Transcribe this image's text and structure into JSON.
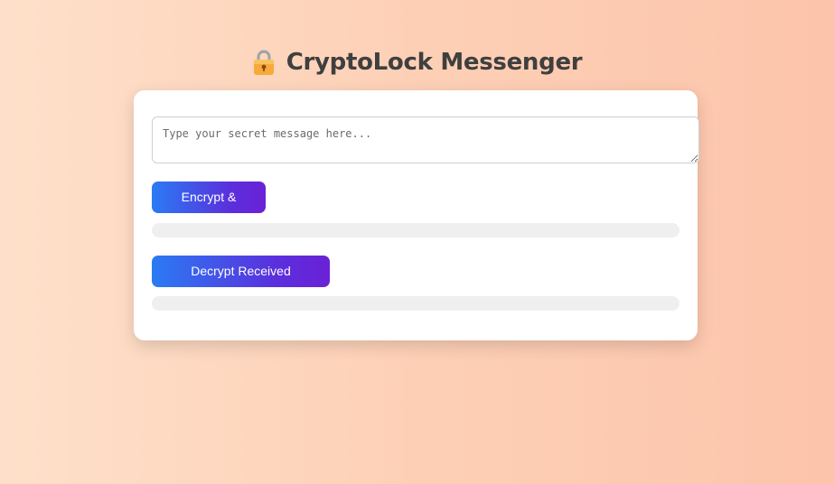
{
  "app": {
    "title": "CryptoLock Messenger",
    "title_icon": "lock-icon"
  },
  "composer": {
    "message_value": "",
    "message_placeholder": "Type your secret message here..."
  },
  "actions": {
    "encrypt_label": "Encrypt & Send",
    "decrypt_label": "Decrypt Received Message"
  },
  "outputs": {
    "encrypted_text": "",
    "decrypted_text": ""
  },
  "colors": {
    "background_start": "#fee0ca",
    "background_end": "#fcc4ab",
    "button_gradient_start": "#2a7bf4",
    "button_gradient_end": "#6a21d6",
    "title_color": "#3f3f3f",
    "output_bg": "#efefef"
  }
}
